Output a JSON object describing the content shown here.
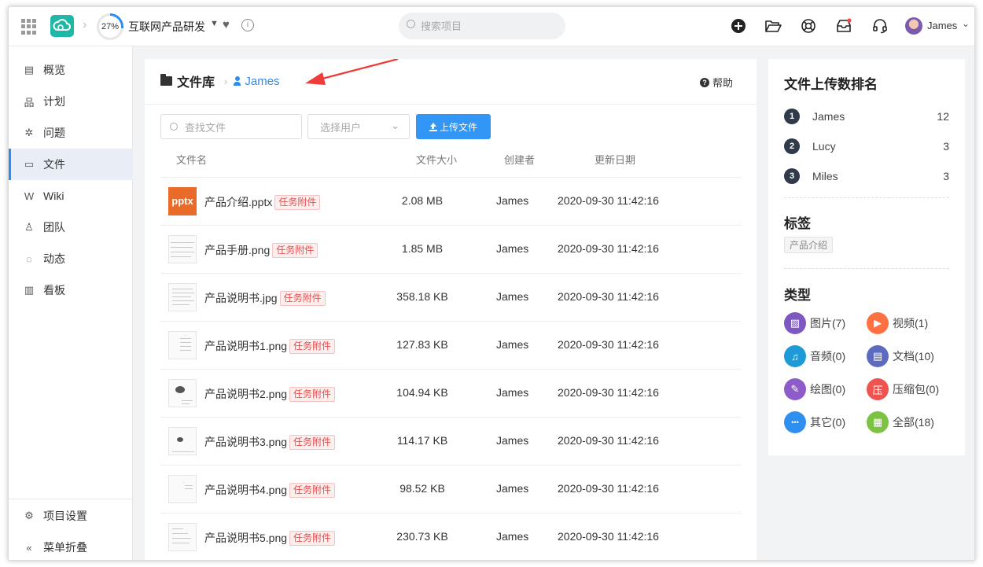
{
  "topbar": {
    "progress_label": "27%",
    "progress_value": 27,
    "project_title": "互联网产品研发",
    "search_placeholder": "搜索项目",
    "user_name": "James",
    "icons": [
      "apps-grid-icon",
      "cloud-logo",
      "chevron-right-icon",
      "caret-down-icon",
      "heart-icon",
      "info-icon",
      "search-icon",
      "add-circle-icon",
      "folder-open-icon",
      "help-ring-icon",
      "inbox-icon",
      "headset-icon",
      "avatar",
      "chevron-down-icon"
    ]
  },
  "sidebar": {
    "items": [
      {
        "label": "概览",
        "icon": "overview-icon",
        "glyph": "▤"
      },
      {
        "label": "计划",
        "icon": "plan-icon",
        "glyph": "品"
      },
      {
        "label": "问题",
        "icon": "bug-icon",
        "glyph": "✲"
      },
      {
        "label": "文件",
        "icon": "folder-icon",
        "glyph": "▭"
      },
      {
        "label": "Wiki",
        "icon": "wiki-icon",
        "glyph": "W"
      },
      {
        "label": "团队",
        "icon": "team-icon",
        "glyph": "♙"
      },
      {
        "label": "动态",
        "icon": "activity-icon",
        "glyph": "◌"
      },
      {
        "label": "看板",
        "icon": "board-icon",
        "glyph": "▥"
      }
    ],
    "active_index": 3,
    "settings_label": "项目设置",
    "collapse_label": "菜单折叠"
  },
  "main": {
    "breadcrumb_title": "文件库",
    "breadcrumb_user": "James",
    "help_label": "帮助",
    "file_search_placeholder": "查找文件",
    "user_select_placeholder": "选择用户",
    "upload_label": "上传文件",
    "columns": {
      "name": "文件名",
      "size": "文件大小",
      "creator": "创建者",
      "date": "更新日期"
    },
    "rows": [
      {
        "name": "产品介绍.pptx",
        "tag": "任务附件",
        "size": "2.08 MB",
        "creator": "James",
        "date": "2020-09-30 11:42:16",
        "thumb": "pptx",
        "thumb_label": "pptx"
      },
      {
        "name": "产品手册.png",
        "tag": "任务附件",
        "size": "1.85 MB",
        "creator": "James",
        "date": "2020-09-30 11:42:16",
        "thumb": "image"
      },
      {
        "name": "产品说明书.jpg",
        "tag": "任务附件",
        "size": "358.18 KB",
        "creator": "James",
        "date": "2020-09-30 11:42:16",
        "thumb": "image"
      },
      {
        "name": "产品说明书1.png",
        "tag": "任务附件",
        "size": "127.83 KB",
        "creator": "James",
        "date": "2020-09-30 11:42:16",
        "thumb": "image"
      },
      {
        "name": "产品说明书2.png",
        "tag": "任务附件",
        "size": "104.94 KB",
        "creator": "James",
        "date": "2020-09-30 11:42:16",
        "thumb": "image"
      },
      {
        "name": "产品说明书3.png",
        "tag": "任务附件",
        "size": "114.17 KB",
        "creator": "James",
        "date": "2020-09-30 11:42:16",
        "thumb": "image"
      },
      {
        "name": "产品说明书4.png",
        "tag": "任务附件",
        "size": "98.52 KB",
        "creator": "James",
        "date": "2020-09-30 11:42:16",
        "thumb": "image"
      },
      {
        "name": "产品说明书5.png",
        "tag": "任务附件",
        "size": "230.73 KB",
        "creator": "James",
        "date": "2020-09-30 11:42:16",
        "thumb": "image"
      }
    ]
  },
  "right": {
    "ranking_title": "文件上传数排名",
    "ranking": [
      {
        "rank": "1",
        "name": "James",
        "count": "12"
      },
      {
        "rank": "2",
        "name": "Lucy",
        "count": "3"
      },
      {
        "rank": "3",
        "name": "Miles",
        "count": "3"
      }
    ],
    "tags_title": "标签",
    "tags": [
      "产品介绍"
    ],
    "types_title": "类型",
    "types": [
      {
        "label": "图片(7)",
        "color": "#7e57c2",
        "icon": "image-icon"
      },
      {
        "label": "视频(1)",
        "color": "#ff7043",
        "icon": "video-icon"
      },
      {
        "label": "音频(0)",
        "color": "#1e9bd7",
        "icon": "music-icon"
      },
      {
        "label": "文档(10)",
        "color": "#5c6bc0",
        "icon": "document-icon"
      },
      {
        "label": "绘图(0)",
        "color": "#8e5cc9",
        "icon": "drawing-icon"
      },
      {
        "label": "压缩包(0)",
        "color": "#ef5350",
        "icon": "archive-icon"
      },
      {
        "label": "其它(0)",
        "color": "#2f8ff0",
        "icon": "more-icon"
      },
      {
        "label": "全部(18)",
        "color": "#7cc243",
        "icon": "all-icon"
      }
    ]
  },
  "colors": {
    "accent": "#2d8cf0",
    "tag_red": "#e3504f",
    "upload_blue": "#3296f6",
    "logo_teal": "#1fb8a6"
  }
}
